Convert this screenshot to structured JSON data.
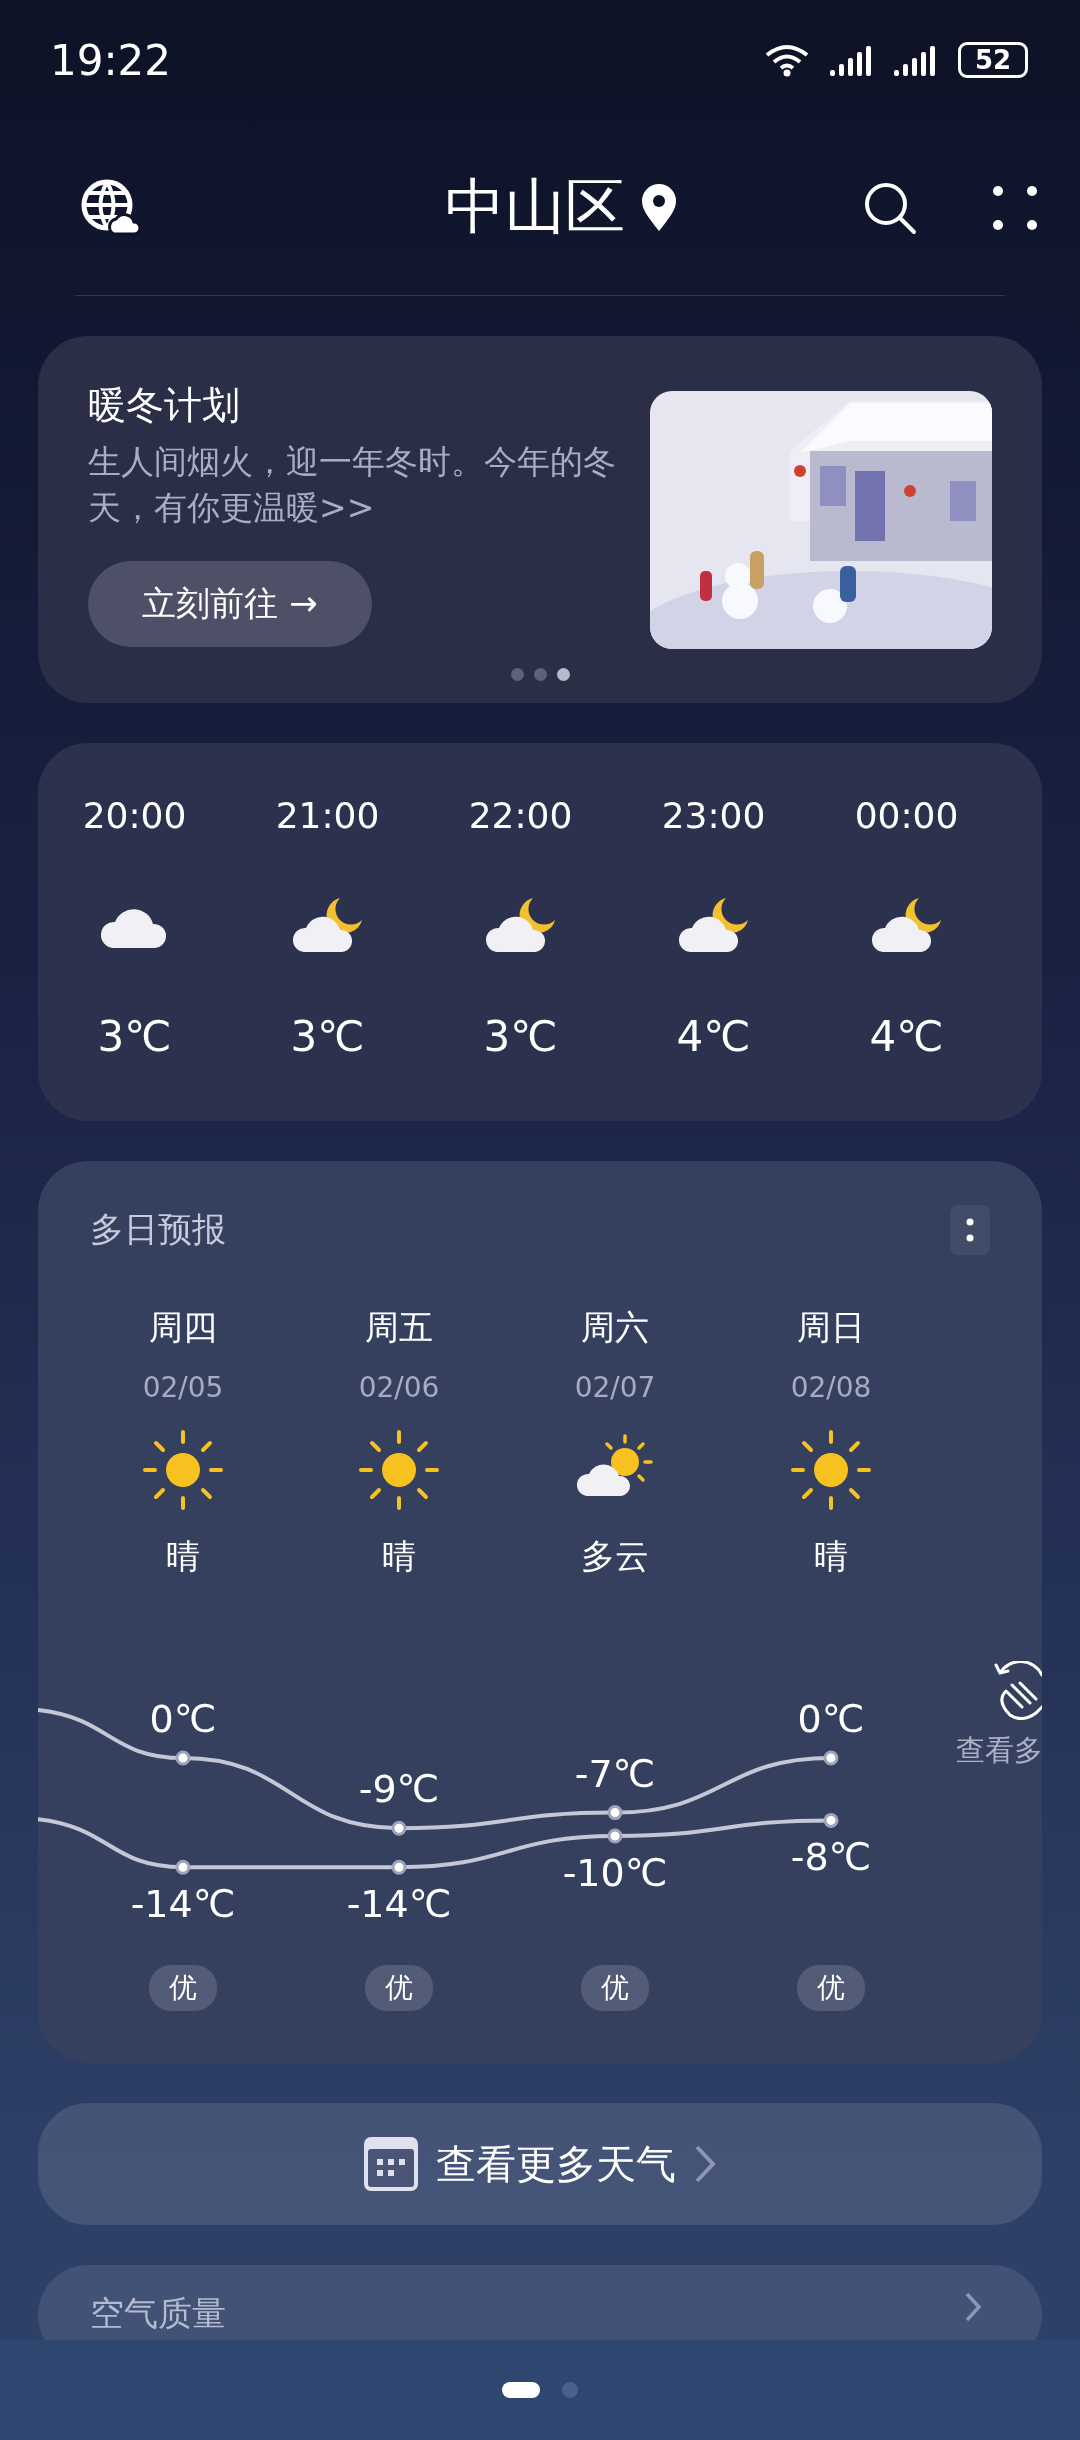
{
  "status_bar": {
    "time": "19:22",
    "battery": "52"
  },
  "header": {
    "city": "中山区"
  },
  "banner": {
    "title": "暖冬计划",
    "text": "生人间烟火，迎一年冬时。今年的冬天，有你更温暖>>",
    "button": "立刻前往 →",
    "page_dots": [
      {
        "selected": false
      },
      {
        "selected": false
      },
      {
        "selected": true
      }
    ]
  },
  "hourly": [
    {
      "time": "20:00",
      "kind": "cloudy",
      "temp": "3℃"
    },
    {
      "time": "21:00",
      "kind": "night_cloudy",
      "temp": "3℃"
    },
    {
      "time": "22:00",
      "kind": "night_cloudy",
      "temp": "3℃"
    },
    {
      "time": "23:00",
      "kind": "night_cloudy",
      "temp": "4℃"
    },
    {
      "time": "00:00",
      "kind": "night_cloudy",
      "temp": "4℃"
    }
  ],
  "forecast": {
    "title": "多日预报",
    "hint": "查看多",
    "days": [
      {
        "day": "周四",
        "date": "02/05",
        "kind": "sunny",
        "weather": "晴",
        "high": "0℃",
        "low": "-14℃",
        "aqi": "优"
      },
      {
        "day": "周五",
        "date": "02/06",
        "kind": "sunny",
        "weather": "晴",
        "high": "-9℃",
        "low": "-14℃",
        "aqi": "优"
      },
      {
        "day": "周六",
        "date": "02/07",
        "kind": "partly_cloudy",
        "weather": "多云",
        "high": "-7℃",
        "low": "-10℃",
        "aqi": "优"
      },
      {
        "day": "周日",
        "date": "02/08",
        "kind": "sunny",
        "weather": "晴",
        "high": "0℃",
        "low": "-8℃",
        "aqi": "优"
      }
    ]
  },
  "more_button": "查看更多天气",
  "air_quality": {
    "title": "空气质量"
  },
  "pager": [
    {
      "selected": true
    },
    {
      "selected": false
    }
  ]
}
